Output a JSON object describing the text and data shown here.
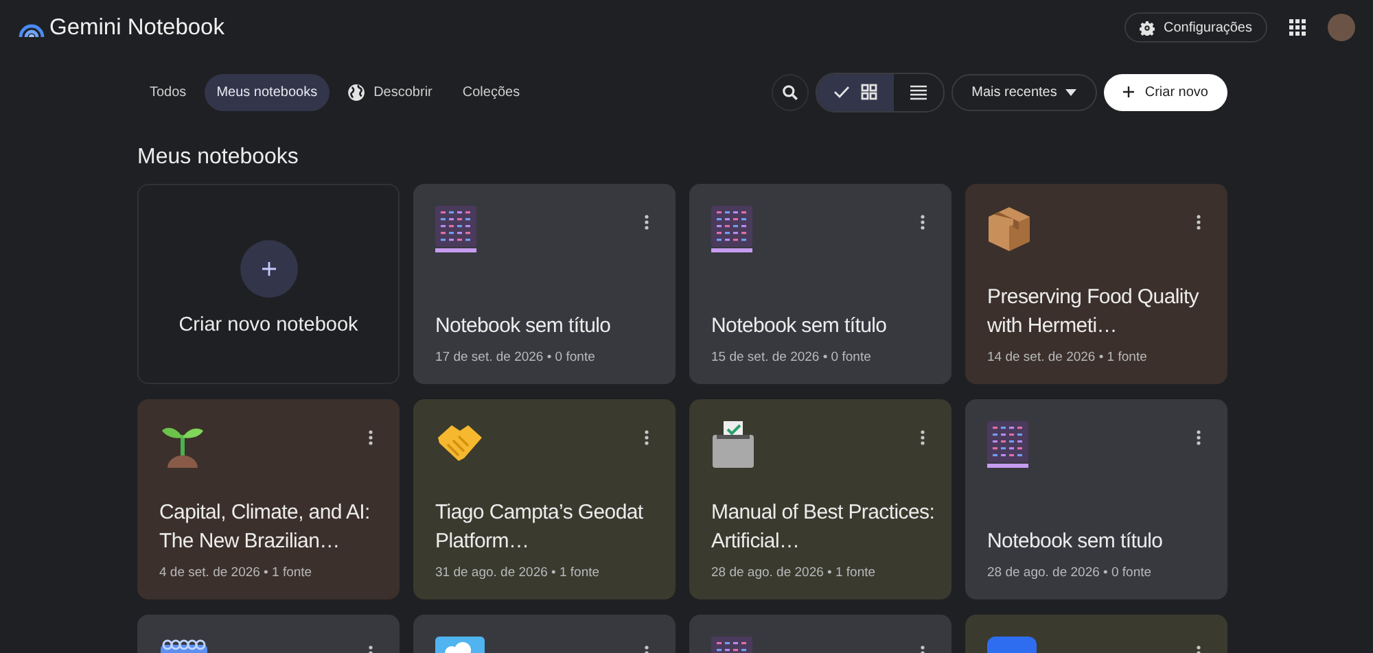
{
  "app": {
    "title": "Gemini Notebook",
    "settings_label": "Configurações"
  },
  "tabs": [
    {
      "label": "Todos",
      "selected": false,
      "kind": "plain"
    },
    {
      "label": "Meus notebooks",
      "selected": true,
      "kind": "plain"
    },
    {
      "label": "Descobrir",
      "selected": false,
      "kind": "globe"
    },
    {
      "label": "Coleções",
      "selected": false,
      "kind": "plain"
    }
  ],
  "view_toggle": [
    {
      "kind": "grid",
      "selected": true
    },
    {
      "kind": "list",
      "selected": false
    }
  ],
  "sort": {
    "label": "Mais recentes"
  },
  "create_button": {
    "label": "Criar novo"
  },
  "heading": "Meus notebooks",
  "create_card": {
    "label": "Criar novo notebook"
  },
  "notebooks": [
    {
      "kind": "notebook",
      "color": "#37393f",
      "title": "Notebook sem título",
      "meta": "17 de set. de 2026 • 0 fonte"
    },
    {
      "kind": "notebook",
      "color": "#37393f",
      "title": "Notebook sem título",
      "meta": "15 de set. de 2026 • 0 fonte"
    },
    {
      "kind": "box",
      "color": "#3b302b",
      "title": "Preserving Food Quality with Hermeti…",
      "meta": "14 de set. de 2026 • 1 fonte"
    },
    {
      "kind": "sprout",
      "color": "#3b302b",
      "title": "Capital, Climate, and AI: The New Brazilian…",
      "meta": "4 de set. de 2026 • 1 fonte"
    },
    {
      "kind": "handshake",
      "color": "#3a3a2e",
      "title": "Tiago Campta’s Geodat Platform…",
      "meta": "31 de ago. de 2026 • 1 fonte"
    },
    {
      "kind": "ballot",
      "color": "#3a3a2e",
      "title": "Manual of Best Practices: Artificial…",
      "meta": "28 de ago. de 2026 • 1 fonte"
    },
    {
      "kind": "notebook",
      "color": "#37393f",
      "title": "Notebook sem título",
      "meta": "28 de ago. de 2026 • 0 fonte"
    },
    {
      "kind": "spiral",
      "color": "#37393f"
    },
    {
      "kind": "photo",
      "color": "#37393f"
    },
    {
      "kind": "notebook",
      "color": "#37393f"
    },
    {
      "kind": "blue",
      "color": "#3a3a2e"
    }
  ]
}
